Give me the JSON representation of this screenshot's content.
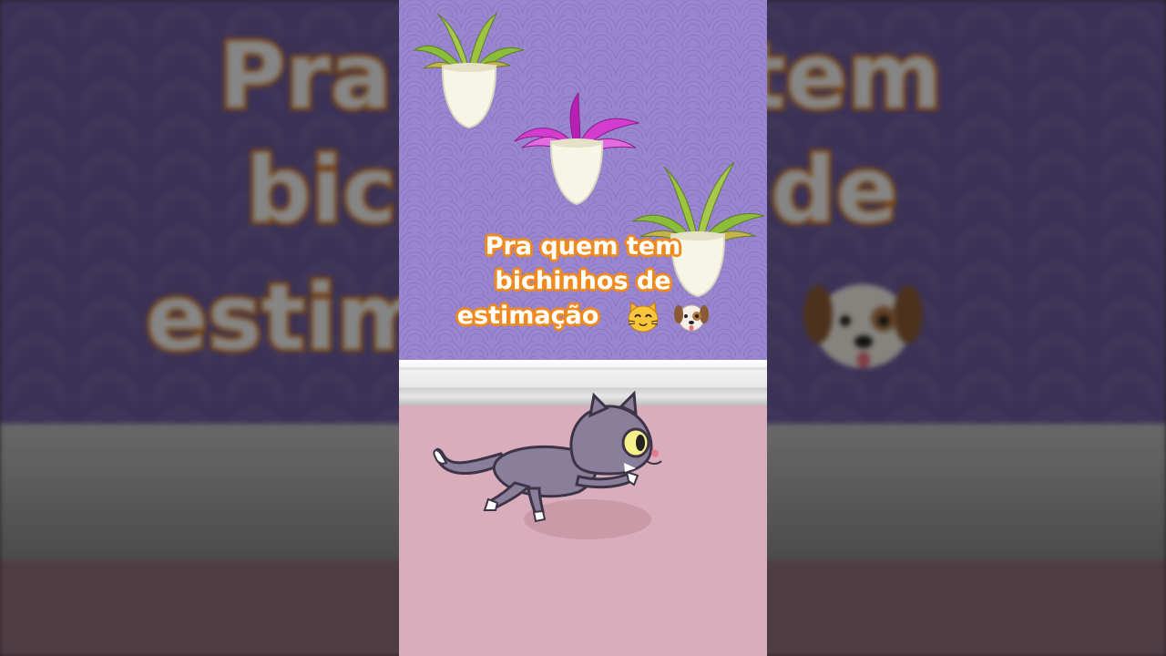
{
  "caption": {
    "line1": "Pra quem tem",
    "line2": "bichinhos de",
    "line3": "estimação"
  },
  "background_text": {
    "row1": "Pra quem tem",
    "row2": "bichinhos de",
    "row3": "estimação"
  },
  "icons": [
    "cat-face-icon",
    "dog-face-icon"
  ],
  "colors": {
    "wall": "#9a85cf",
    "floor": "#d9adbb",
    "caption_outline": "#f08a1c",
    "cat_body": "#8a7f9a"
  }
}
